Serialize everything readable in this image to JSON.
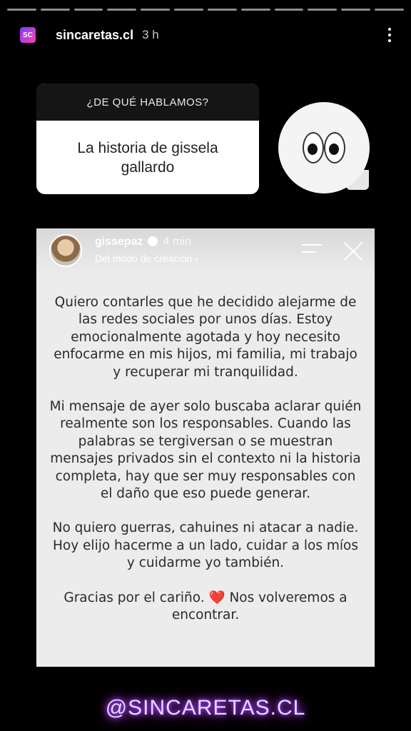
{
  "story": {
    "progress_segments": 12,
    "account": "sincaretas.cl",
    "avatar_text": "SC",
    "time": "3 h"
  },
  "question_sticker": {
    "header": "¿DE QUÉ HABLAMOS?",
    "body": "La historia de gissela gallardo"
  },
  "reposted_story": {
    "username": "gissepaz",
    "time": "4 min",
    "subtitle": "Del modo de creación ›",
    "paragraphs": [
      "Quiero contarles que he decidido alejarme de las redes sociales por unos días. Estoy emocionalmente agotada y hoy necesito enfocarme en mis hijos, mi familia, mi trabajo y recuperar mi tranquilidad.",
      "Mi mensaje de ayer solo buscaba aclarar quién realmente son los responsables. Cuando las palabras se tergiversan o se muestran mensajes privados sin el contexto ni la historia completa, hay que ser muy responsables con el daño que eso puede generar.",
      "No quiero guerras, cahuines ni atacar a nadie. Hoy elijo hacerme a un lado, cuidar a los míos y cuidarme yo también."
    ],
    "closing_before": "Gracias por el cariño.",
    "closing_heart": "❤️",
    "closing_after": "Nos volveremos a encontrar."
  },
  "watermark": "@SINCARETAS.CL"
}
